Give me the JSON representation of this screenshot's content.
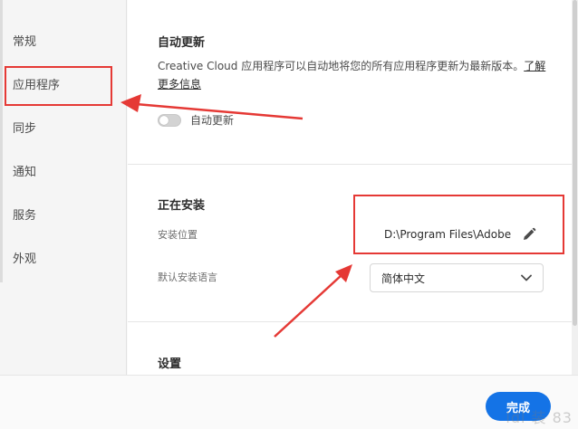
{
  "sidebar": {
    "items": [
      {
        "label": "常规"
      },
      {
        "label": "应用程序"
      },
      {
        "label": "同步"
      },
      {
        "label": "通知"
      },
      {
        "label": "服务"
      },
      {
        "label": "外观"
      }
    ]
  },
  "auto_update": {
    "title": "自动更新",
    "description": "Creative Cloud 应用程序可以自动地将您的所有应用程序更新为最新版本。",
    "link": "了解更多信息",
    "toggle_label": "自动更新",
    "toggle_on": false
  },
  "installing": {
    "title": "正在安装",
    "location_label": "安装位置",
    "location_value": "D:\\Program Files\\Adobe",
    "language_label": "默认安装语言",
    "language_value": "简体中文"
  },
  "settings": {
    "title": "设置"
  },
  "footer": {
    "done_label": "完成"
  },
  "watermark": "ldl 装 83",
  "colors": {
    "accent": "#1473e6",
    "annotation": "#e53935"
  },
  "icons": [
    "pencil-icon",
    "chevron-down-icon"
  ]
}
